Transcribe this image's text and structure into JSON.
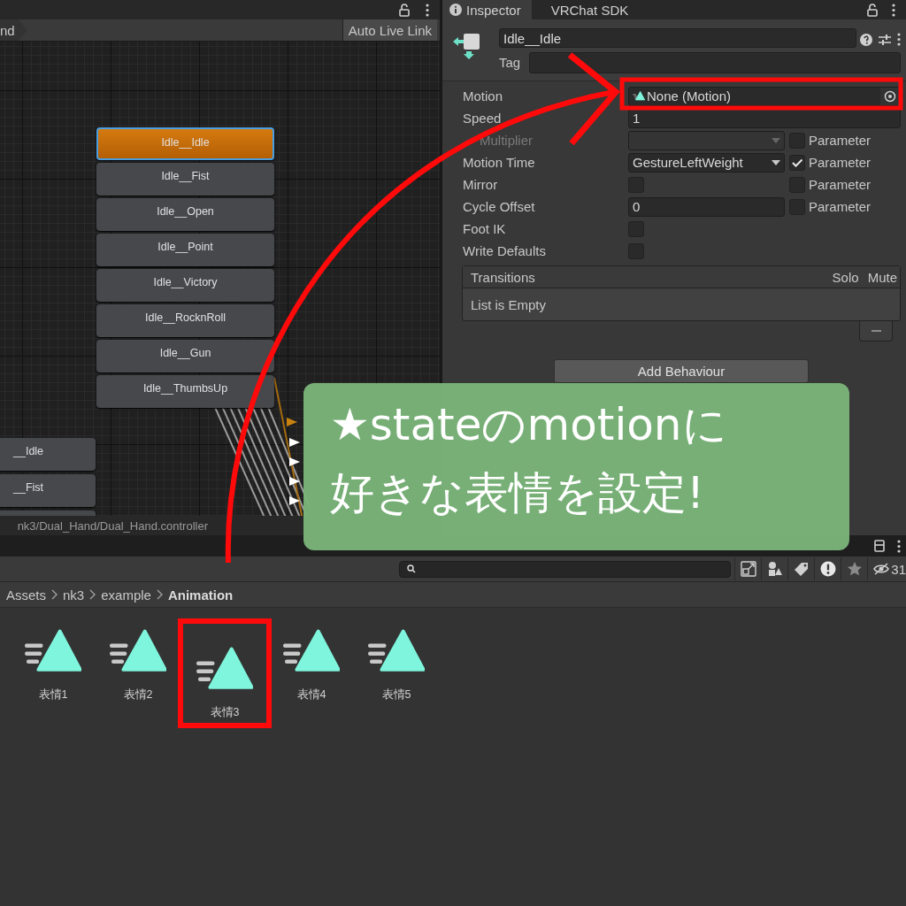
{
  "graph": {
    "breadcrumb": "nd",
    "live_link": "Auto Live Link",
    "path": "nk3/Dual_Hand/Dual_Hand.controller",
    "nodes": [
      {
        "label": "Idle__Idle",
        "selected": true
      },
      {
        "label": "Idle__Fist",
        "selected": false
      },
      {
        "label": "Idle__Open",
        "selected": false
      },
      {
        "label": "Idle__Point",
        "selected": false
      },
      {
        "label": "Idle__Victory",
        "selected": false
      },
      {
        "label": "Idle__RocknRoll",
        "selected": false
      },
      {
        "label": "Idle__Gun",
        "selected": false
      },
      {
        "label": "Idle__ThumbsUp",
        "selected": false
      }
    ],
    "side_nodes": [
      {
        "label": "__Idle"
      },
      {
        "label": "__Fist"
      }
    ]
  },
  "inspector": {
    "tabs": [
      {
        "label": "Inspector",
        "selected": true
      },
      {
        "label": "VRChat SDK",
        "selected": false
      }
    ],
    "name": "Idle__Idle",
    "tag_label": "Tag",
    "rows": [
      {
        "kind": "object",
        "label": "Motion",
        "value": "None (Motion)",
        "disabled": false,
        "highlighted": true
      },
      {
        "kind": "text",
        "label": "Speed",
        "value": "1",
        "disabled": false
      },
      {
        "kind": "dropdown",
        "label": "Multiplier",
        "disabled": true,
        "param": {
          "label": "Parameter",
          "checked": false
        }
      },
      {
        "kind": "dropdown",
        "label": "Motion Time",
        "value": "GestureLeftWeight",
        "disabled": false,
        "param": {
          "label": "Parameter",
          "checked": true
        }
      },
      {
        "kind": "checkbox",
        "label": "Mirror",
        "checked": false,
        "disabled": false,
        "param": {
          "label": "Parameter",
          "checked": false
        }
      },
      {
        "kind": "number",
        "label": "Cycle Offset",
        "value": "0",
        "disabled": false,
        "param": {
          "label": "Parameter",
          "checked": false
        }
      },
      {
        "kind": "checkbox",
        "label": "Foot IK",
        "checked": false,
        "disabled": false
      },
      {
        "kind": "checkbox",
        "label": "Write Defaults",
        "checked": false,
        "disabled": false
      }
    ],
    "transitions": {
      "title": "Transitions",
      "solo": "Solo",
      "mute": "Mute",
      "empty": "List is Empty"
    },
    "add_behaviour": "Add Behaviour"
  },
  "project": {
    "hidden_count": "31",
    "breadcrumbs": [
      {
        "label": "Assets",
        "current": false
      },
      {
        "label": "nk3",
        "current": false
      },
      {
        "label": "example",
        "current": false
      },
      {
        "label": "Animation",
        "current": true
      }
    ],
    "assets": [
      {
        "label": "表情1",
        "highlighted": false
      },
      {
        "label": "表情2",
        "highlighted": false
      },
      {
        "label": "表情3",
        "highlighted": true
      },
      {
        "label": "表情4",
        "highlighted": false
      },
      {
        "label": "表情5",
        "highlighted": false
      }
    ]
  },
  "callout": {
    "lines": [
      "★stateのmotionに",
      "好きな表情を設定!"
    ]
  }
}
